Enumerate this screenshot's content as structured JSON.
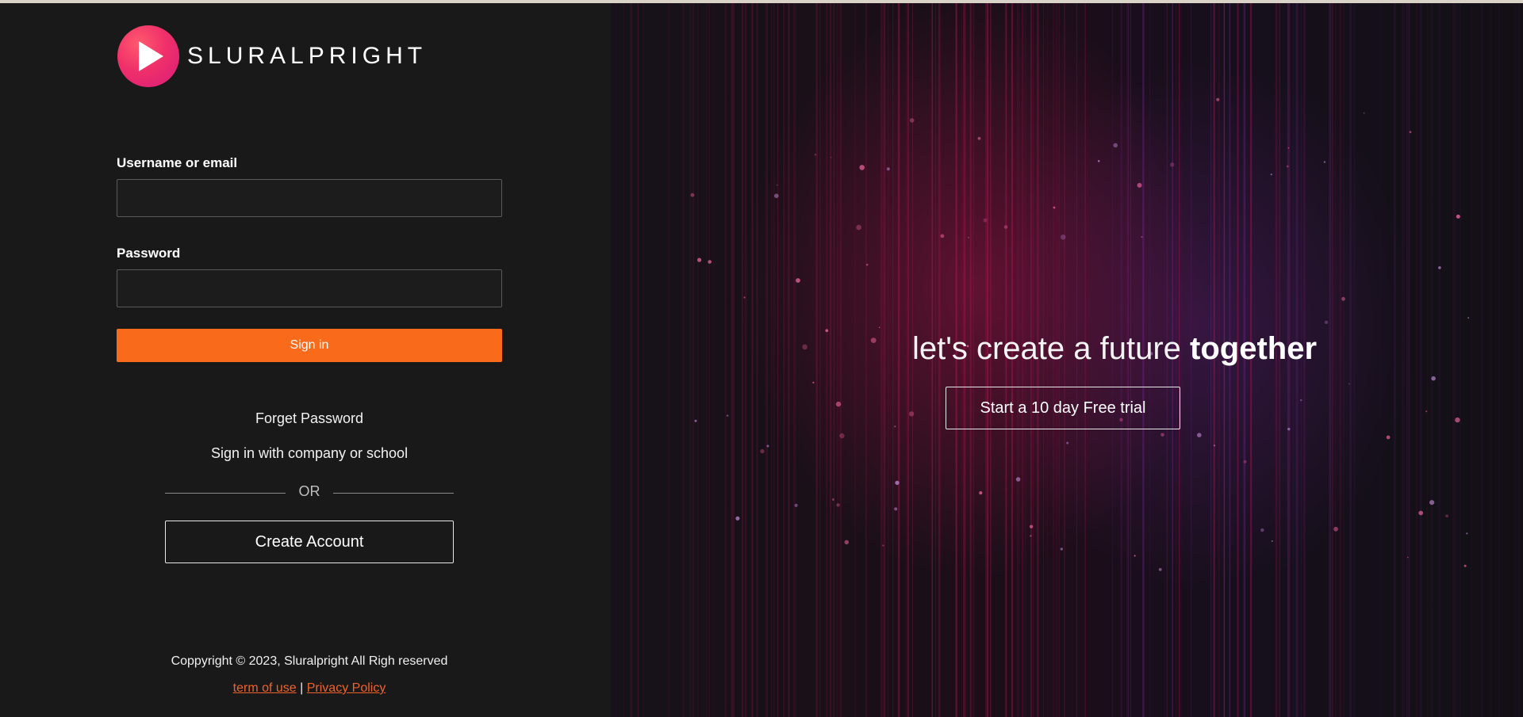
{
  "brand": {
    "name": "SLURALPRIGHT",
    "logo_icon": "play-icon",
    "accent": "#f96a1a",
    "logo_color": "#f0306a"
  },
  "login": {
    "username_label": "Username or email",
    "username_value": "",
    "password_label": "Password",
    "password_value": "",
    "signin_label": "Sign in",
    "forget_password": "Forget Password",
    "sso_link": "Sign in with company or school",
    "or_text": "OR",
    "create_account": "Create Account"
  },
  "footer": {
    "copyright": "Coppyright © 2023, Sluralpright All Righ reserved",
    "terms": "term of use",
    "separator": "|",
    "privacy": "Privacy Policy",
    "link_color": "#f0622a"
  },
  "hero": {
    "tagline_light": "let's create a future",
    "tagline_bold": "together",
    "trial_button": "Start a 10 day Free trial"
  }
}
